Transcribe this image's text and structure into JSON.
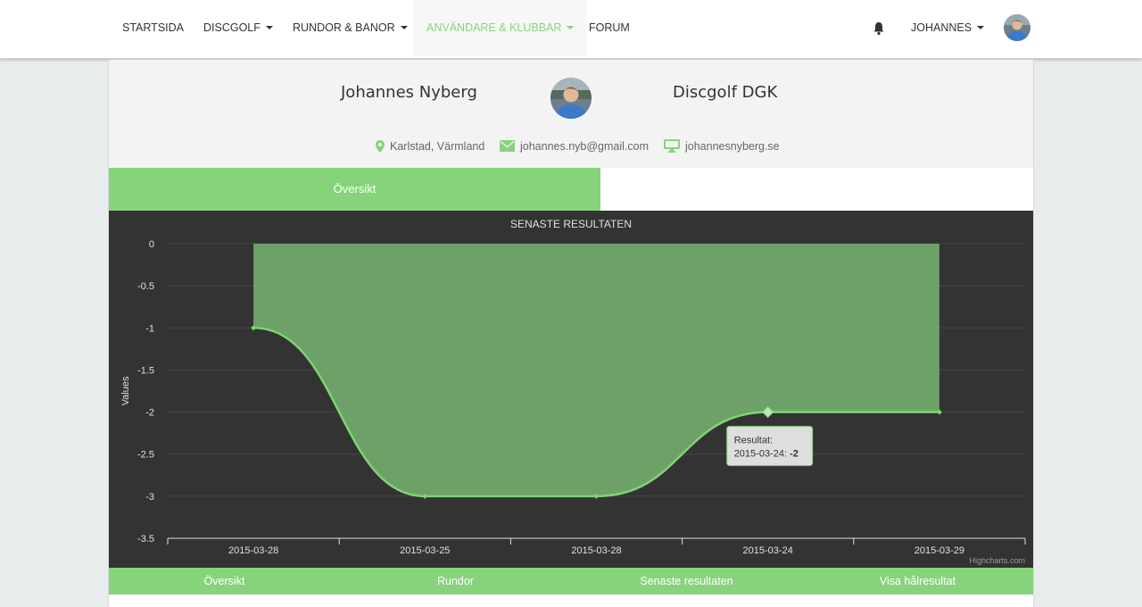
{
  "nav": {
    "items": [
      {
        "label": "STARTSIDA",
        "dropdown": false,
        "active": false
      },
      {
        "label": "DISCGOLF",
        "dropdown": true,
        "active": false
      },
      {
        "label": "RUNDOR & BANOR",
        "dropdown": true,
        "active": false
      },
      {
        "label": "ANVÄNDARE & KLUBBAR",
        "dropdown": true,
        "active": true
      },
      {
        "label": "FORUM",
        "dropdown": false,
        "active": false
      }
    ],
    "user_label": "JOHANNES",
    "icons": {
      "bell": "bell-icon",
      "avatar": "user-avatar"
    }
  },
  "profile": {
    "name": "Johannes Nyberg",
    "club": "Discgolf DGK",
    "location": "Karlstad, Värmland",
    "email": "johannes.nyb@gmail.com",
    "website": "johannesnyberg.se"
  },
  "tabs": {
    "active": "Översikt"
  },
  "bottom_tabs": [
    "Översikt",
    "Rundor",
    "Senaste resultaten",
    "Visa hålresultat"
  ],
  "colors": {
    "accent": "#87d37c",
    "chart_bg": "#333333",
    "area_fill": "#72a86a"
  },
  "chart_data": {
    "type": "area",
    "title": "SENASTE RESULTATEN",
    "xlabel": "",
    "ylabel": "Values",
    "categories": [
      "2015-03-28",
      "2015-03-25",
      "2015-03-28",
      "2015-03-24",
      "2015-03-29"
    ],
    "series": [
      {
        "name": "Resultat",
        "values": [
          -1,
          -3,
          -3,
          -2,
          -2
        ]
      }
    ],
    "ylim": [
      -3.5,
      0
    ],
    "yticks": [
      0,
      -0.5,
      -1,
      -1.5,
      -2,
      -2.5,
      -3,
      -3.5
    ],
    "grid": true,
    "credits": "Highcharts.com",
    "tooltip": {
      "title": "Resultat:",
      "date": "2015-03-24",
      "value": "-2"
    }
  }
}
